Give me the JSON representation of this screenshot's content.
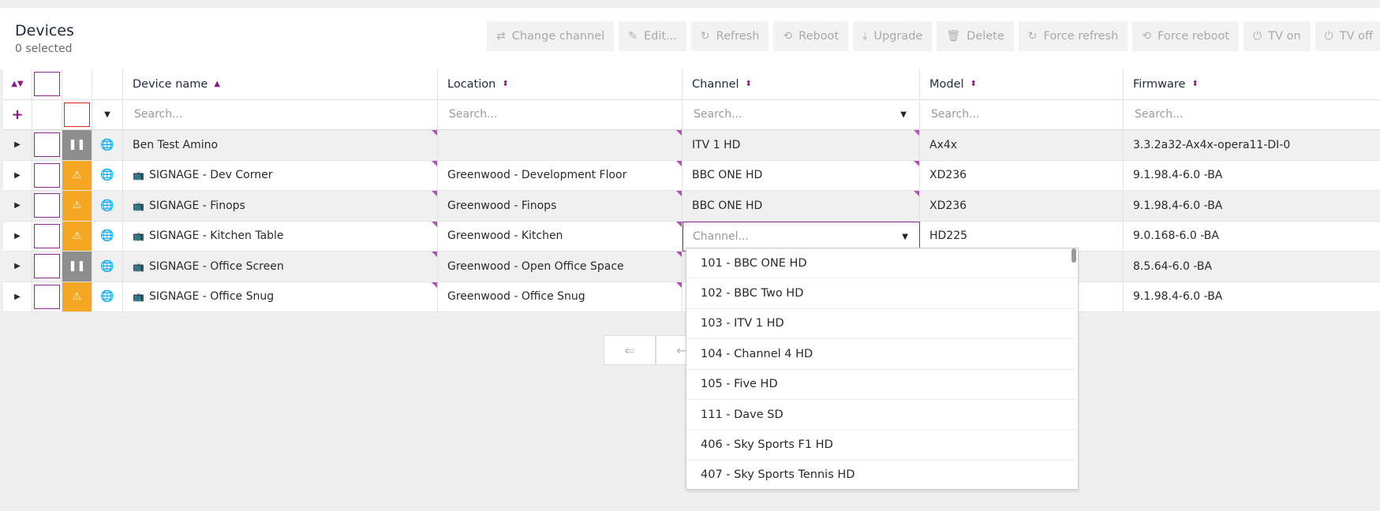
{
  "header": {
    "title": "Devices",
    "subtitle": "0 selected"
  },
  "toolbar": [
    {
      "label": "Change channel",
      "icon": "⇄"
    },
    {
      "label": "Edit...",
      "icon": "✎"
    },
    {
      "label": "Refresh",
      "icon": "↻"
    },
    {
      "label": "Reboot",
      "icon": "⟲"
    },
    {
      "label": "Upgrade",
      "icon": "⤓"
    },
    {
      "label": "Delete",
      "icon": "🗑"
    },
    {
      "label": "Force refresh",
      "icon": "↻"
    },
    {
      "label": "Force reboot",
      "icon": "⟲"
    },
    {
      "label": "TV on",
      "icon": "⏻"
    },
    {
      "label": "TV off",
      "icon": "⏻"
    }
  ],
  "columns": [
    "Device name",
    "Location",
    "Channel",
    "Model",
    "Firmware"
  ],
  "search_placeholder": "Search...",
  "channel_placeholder": "Channel...",
  "rows": [
    {
      "name": "Ben Test Amino",
      "location": "",
      "channel": "ITV 1 HD",
      "model": "Ax4x",
      "firmware": "3.3.2a32-Ax4x-opera11-DI-0",
      "status": "paused",
      "tv": false
    },
    {
      "name": "SIGNAGE - Dev Corner",
      "location": "Greenwood - Development Floor",
      "channel": "BBC ONE HD",
      "model": "XD236",
      "firmware": "9.1.98.4-6.0 -BA",
      "status": "warn",
      "tv": true
    },
    {
      "name": "SIGNAGE - Finops",
      "location": "Greenwood - Finops",
      "channel": "BBC ONE HD",
      "model": "XD236",
      "firmware": "9.1.98.4-6.0 -BA",
      "status": "warn",
      "tv": true
    },
    {
      "name": "SIGNAGE - Kitchen Table",
      "location": "Greenwood - Kitchen",
      "channel": "",
      "model": "HD225",
      "firmware": "9.0.168-6.0 -BA",
      "status": "warn",
      "tv": true,
      "editing": true
    },
    {
      "name": "SIGNAGE - Office Screen",
      "location": "Greenwood - Open Office Space",
      "channel": "",
      "model": "",
      "firmware": "8.5.64-6.0 -BA",
      "status": "paused",
      "tv": true
    },
    {
      "name": "SIGNAGE - Office Snug",
      "location": "Greenwood - Office Snug",
      "channel": "",
      "model": "",
      "firmware": "9.1.98.4-6.0 -BA",
      "status": "warn",
      "tv": true
    }
  ],
  "channel_options": [
    "101 - BBC ONE HD",
    "102 - BBC Two HD",
    "103 - ITV 1 HD",
    "104 - Channel 4 HD",
    "105 - Five HD",
    "111 - Dave SD",
    "406 - Sky Sports F1 HD",
    "407 - Sky Sports Tennis HD"
  ],
  "colors": {
    "accent": "#8a2a8a",
    "warn": "#f5a623",
    "paused": "#8e8e8e"
  }
}
